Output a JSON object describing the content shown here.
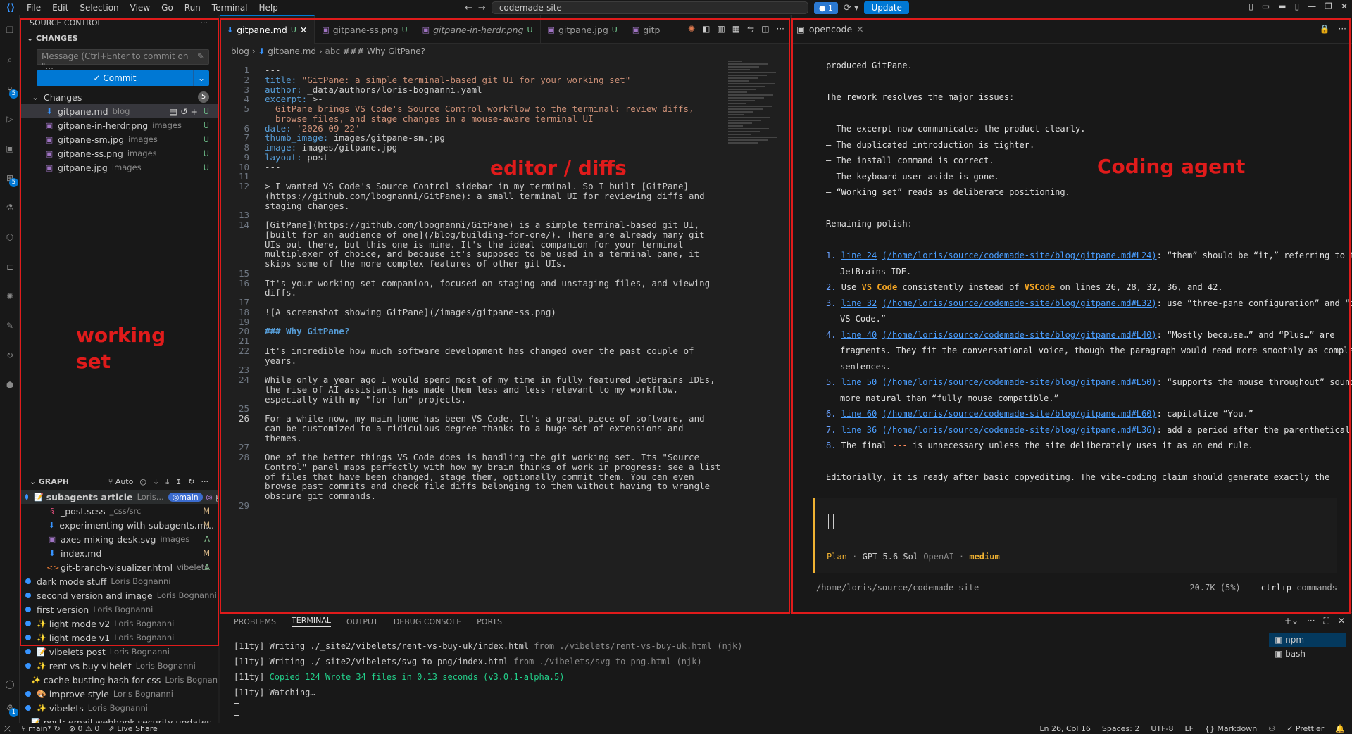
{
  "menu": [
    "File",
    "Edit",
    "Selection",
    "View",
    "Go",
    "Run",
    "Terminal",
    "Help"
  ],
  "command_center": "codemade-site",
  "account_badge": "1",
  "update_label": "Update",
  "sidebar": {
    "title": "SOURCE CONTROL",
    "changes_header": "CHANGES",
    "commit_placeholder": "Message (Ctrl+Enter to commit on \"...",
    "commit_label": "Commit",
    "changes_group": "Changes",
    "changes_count": "5",
    "files": [
      {
        "name": "gitpane.md",
        "dir": "blog",
        "status": "U"
      },
      {
        "name": "gitpane-in-herdr.png",
        "dir": "images",
        "status": "U"
      },
      {
        "name": "gitpane-sm.jpg",
        "dir": "images",
        "status": "U"
      },
      {
        "name": "gitpane-ss.png",
        "dir": "images",
        "status": "U"
      },
      {
        "name": "gitpane.jpg",
        "dir": "images",
        "status": "U"
      }
    ],
    "graph_title": "GRAPH",
    "graph_auto": "Auto",
    "graph_head": {
      "title": "subagents article",
      "author": "Loris...",
      "branch": "main"
    },
    "graph_head_files": [
      {
        "name": "_post.scss",
        "dir": "_css/src",
        "status": "M"
      },
      {
        "name": "experimenting-with-subagents.m...",
        "dir": "",
        "status": "M"
      },
      {
        "name": "axes-mixing-desk.svg",
        "dir": "images",
        "status": "A"
      },
      {
        "name": "index.md",
        "dir": "",
        "status": "M"
      },
      {
        "name": "git-branch-visualizer.html",
        "dir": "vibelets",
        "status": "A"
      }
    ],
    "commits": [
      {
        "emoji": "",
        "title": "dark mode stuff",
        "author": "Loris Bognanni"
      },
      {
        "emoji": "",
        "title": "second version and image",
        "author": "Loris Bognanni"
      },
      {
        "emoji": "",
        "title": "first version",
        "author": "Loris Bognanni"
      },
      {
        "emoji": "✨",
        "title": "light mode v2",
        "author": "Loris Bognanni"
      },
      {
        "emoji": "✨",
        "title": "light mode v1",
        "author": "Loris Bognanni"
      },
      {
        "emoji": "📝",
        "title": "vibelets post",
        "author": "Loris Bognanni"
      },
      {
        "emoji": "✨",
        "title": "rent vs buy vibelet",
        "author": "Loris Bognanni"
      },
      {
        "emoji": "✨",
        "title": "cache busting hash for css",
        "author": "Loris Bognanni"
      },
      {
        "emoji": "🎨",
        "title": "improve style",
        "author": "Loris Bognanni"
      },
      {
        "emoji": "✨",
        "title": "vibelets",
        "author": "Loris Bognanni"
      },
      {
        "emoji": "📝",
        "title": "post: email webhook security updates...",
        "author": ""
      }
    ]
  },
  "editor": {
    "tabs": [
      {
        "name": "gitpane.md",
        "status": "U",
        "active": true
      },
      {
        "name": "gitpane-ss.png",
        "status": "U",
        "active": false
      },
      {
        "name": "gitpane-in-herdr.png",
        "status": "U",
        "active": false
      },
      {
        "name": "gitpane.jpg",
        "status": "U",
        "active": false
      },
      {
        "name": "gitp",
        "status": "",
        "active": false
      }
    ],
    "breadcrumb": [
      "blog",
      "gitpane.md",
      "### Why GitPane?"
    ],
    "lines": [
      {
        "n": "1",
        "t": "---"
      },
      {
        "n": "2",
        "t": "title: \"GitPane: a simple terminal-based git UI for your working set\""
      },
      {
        "n": "3",
        "t": "author: _data/authors/loris-bognanni.yaml"
      },
      {
        "n": "4",
        "t": "excerpt: >-"
      },
      {
        "n": "5",
        "t": "  GitPane brings VS Code's Source Control workflow to the terminal: review diffs,"
      },
      {
        "n": "",
        "t": "  browse files, and stage changes in a mouse-aware terminal UI"
      },
      {
        "n": "6",
        "t": "date: '2026-09-22'"
      },
      {
        "n": "7",
        "t": "thumb_image: images/gitpane-sm.jpg"
      },
      {
        "n": "8",
        "t": "image: images/gitpane.jpg"
      },
      {
        "n": "9",
        "t": "layout: post"
      },
      {
        "n": "10",
        "t": "---"
      },
      {
        "n": "11",
        "t": ""
      },
      {
        "n": "12",
        "t": "> I wanted VS Code's Source Control sidebar in my terminal. So I built [GitPane]"
      },
      {
        "n": "",
        "t": "(https://github.com/lbognanni/GitPane): a small terminal UI for reviewing diffs and"
      },
      {
        "n": "",
        "t": "staging changes."
      },
      {
        "n": "13",
        "t": ""
      },
      {
        "n": "14",
        "t": "[GitPane](https://github.com/lbognanni/GitPane) is a simple terminal-based git UI,"
      },
      {
        "n": "",
        "t": "[built for an audience of one](/blog/building-for-one/). There are already many git"
      },
      {
        "n": "",
        "t": "UIs out there, but this one is mine. It's the ideal companion for your terminal"
      },
      {
        "n": "",
        "t": "multiplexer of choice, and because it's supposed to be used in a terminal pane, it"
      },
      {
        "n": "",
        "t": "skips some of the more complex features of other git UIs."
      },
      {
        "n": "15",
        "t": ""
      },
      {
        "n": "16",
        "t": "It's your working set companion, focused on staging and unstaging files, and viewing"
      },
      {
        "n": "",
        "t": "diffs."
      },
      {
        "n": "17",
        "t": ""
      },
      {
        "n": "18",
        "t": "![A screenshot showing GitPane](/images/gitpane-ss.png)"
      },
      {
        "n": "19",
        "t": ""
      },
      {
        "n": "20",
        "t": "### Why GitPane?"
      },
      {
        "n": "21",
        "t": ""
      },
      {
        "n": "22",
        "t": "It's incredible how much software development has changed over the past couple of"
      },
      {
        "n": "",
        "t": "years."
      },
      {
        "n": "23",
        "t": ""
      },
      {
        "n": "24",
        "t": "While only a year ago I would spend most of my time in fully featured JetBrains IDEs,"
      },
      {
        "n": "",
        "t": "the rise of AI assistants has made them less and less relevant to my workflow,"
      },
      {
        "n": "",
        "t": "especially with my \"for fun\" projects."
      },
      {
        "n": "25",
        "t": ""
      },
      {
        "n": "26",
        "t": "For a while now, my main home has been VS Code. It's a great piece of software, and"
      },
      {
        "n": "",
        "t": "can be customized to a ridiculous degree thanks to a huge set of extensions and"
      },
      {
        "n": "",
        "t": "themes."
      },
      {
        "n": "27",
        "t": ""
      },
      {
        "n": "28",
        "t": "One of the better things VS Code does is handling the git working set. Its \"Source"
      },
      {
        "n": "",
        "t": "Control\" panel maps perfectly with how my brain thinks of work in progress: see a list"
      },
      {
        "n": "",
        "t": "of files that have been changed, stage them, optionally commit them. You can even"
      },
      {
        "n": "",
        "t": "browse past commits and check file diffs belonging to them without having to wrangle"
      },
      {
        "n": "",
        "t": "obscure git commands."
      },
      {
        "n": "29",
        "t": ""
      }
    ]
  },
  "agent": {
    "tab": "opencode",
    "lines": [
      {
        "kind": "text",
        "t": "produced GitPane."
      },
      {
        "kind": "blank",
        "t": ""
      },
      {
        "kind": "text",
        "t": "The rework resolves the major issues:"
      },
      {
        "kind": "blank",
        "t": ""
      },
      {
        "kind": "text",
        "t": "– The excerpt now communicates the product clearly."
      },
      {
        "kind": "text",
        "t": "– The duplicated introduction is tighter."
      },
      {
        "kind": "text",
        "t": "– The install command is correct."
      },
      {
        "kind": "text",
        "t": "– The keyboard-user aside is gone."
      },
      {
        "kind": "text",
        "t": "– “Working set” reads as deliberate positioning."
      },
      {
        "kind": "blank",
        "t": ""
      },
      {
        "kind": "text",
        "t": "Remaining polish:"
      },
      {
        "kind": "blank",
        "t": ""
      }
    ],
    "items": [
      {
        "num": "1.",
        "link_line": "line 24",
        "path": "(/home/loris/source/codemade-site/blog/gitpane.md#L24)",
        "text": ": “them” should be “it,” referring to the",
        "cont": [
          "JetBrains IDE."
        ]
      },
      {
        "num": "2.",
        "pre": "Use ",
        "b1": "VS Code",
        "mid": " consistently instead of ",
        "b2": "VSCode",
        "post": " on lines 26, 28, 32, 36, and 42.",
        "cont": []
      },
      {
        "num": "3.",
        "link_line": "line 32",
        "path": "(/home/loris/source/codemade-site/blog/gitpane.md#L32)",
        "text": ": use “three-pane configuration” and “in",
        "cont": [
          "VS Code.”"
        ]
      },
      {
        "num": "4.",
        "link_line": "line 40",
        "path": "(/home/loris/source/codemade-site/blog/gitpane.md#L40)",
        "text": ": “Mostly because…” and “Plus…” are",
        "cont": [
          "fragments. They fit the conversational voice, though the paragraph would read more smoothly as complete",
          "sentences."
        ]
      },
      {
        "num": "5.",
        "link_line": "line 50",
        "path": "(/home/loris/source/codemade-site/blog/gitpane.md#L50)",
        "text": ": “supports the mouse throughout” sounds",
        "cont": [
          "more natural than “fully mouse compatible.”"
        ]
      },
      {
        "num": "6.",
        "link_line": "line 60",
        "path": "(/home/loris/source/codemade-site/blog/gitpane.md#L60)",
        "text": ": capitalize “You.”",
        "cont": []
      },
      {
        "num": "7.",
        "link_line": "line 36",
        "path": "(/home/loris/source/codemade-site/blog/gitpane.md#L36)",
        "text": ": add a period after the parenthetical.",
        "cont": []
      },
      {
        "num": "8.",
        "pre": "The final ",
        "em": "---",
        "post": " is unnecessary unless the site deliberately uses it as an end rule.",
        "cont": []
      }
    ],
    "closing": "Editorially, it is ready after basic copyediting. The vibe-coding claim should generate exactly the",
    "mode": "Plan",
    "model": "GPT-5.6 Sol",
    "provider": "OpenAI",
    "effort": "medium",
    "cwd": "/home/loris/source/codemade-site",
    "tokens": "20.7K (5%)",
    "shortcut_key": "ctrl+p",
    "shortcut_label": "commands"
  },
  "panel": {
    "tabs": [
      "PROBLEMS",
      "TERMINAL",
      "OUTPUT",
      "DEBUG CONSOLE",
      "PORTS"
    ],
    "active_tab": "TERMINAL",
    "term_lines": [
      {
        "pre": "[11ty] Writing ./_site2/vibelets/rent-vs-buy-uk/index.html",
        "dim": " from ./vibelets/rent-vs-buy-uk.html (njk)"
      },
      {
        "pre": "[11ty] Writing ./_site2/vibelets/svg-to-png/index.html",
        "dim": " from ./vibelets/svg-to-png.html (njk)"
      },
      {
        "pre": "[11ty] ",
        "green": "Copied 124 Wrote 34 files in 0.13 seconds (v3.0.1-alpha.5)"
      },
      {
        "pre": "[11ty] Watching…"
      }
    ],
    "terminals": [
      "npm",
      "bash"
    ]
  },
  "status": {
    "branch": "main*",
    "errors": "0",
    "warnings": "0",
    "live_share": "Live Share",
    "position": "Ln 26, Col 16",
    "spaces": "Spaces: 2",
    "encoding": "UTF-8",
    "eol": "LF",
    "language": "Markdown",
    "formatter": "Prettier"
  },
  "annotations": {
    "working_set": [
      "working",
      "set"
    ],
    "editor": "editor / diffs",
    "agent": "Coding agent",
    "color": "#e01b1b"
  }
}
